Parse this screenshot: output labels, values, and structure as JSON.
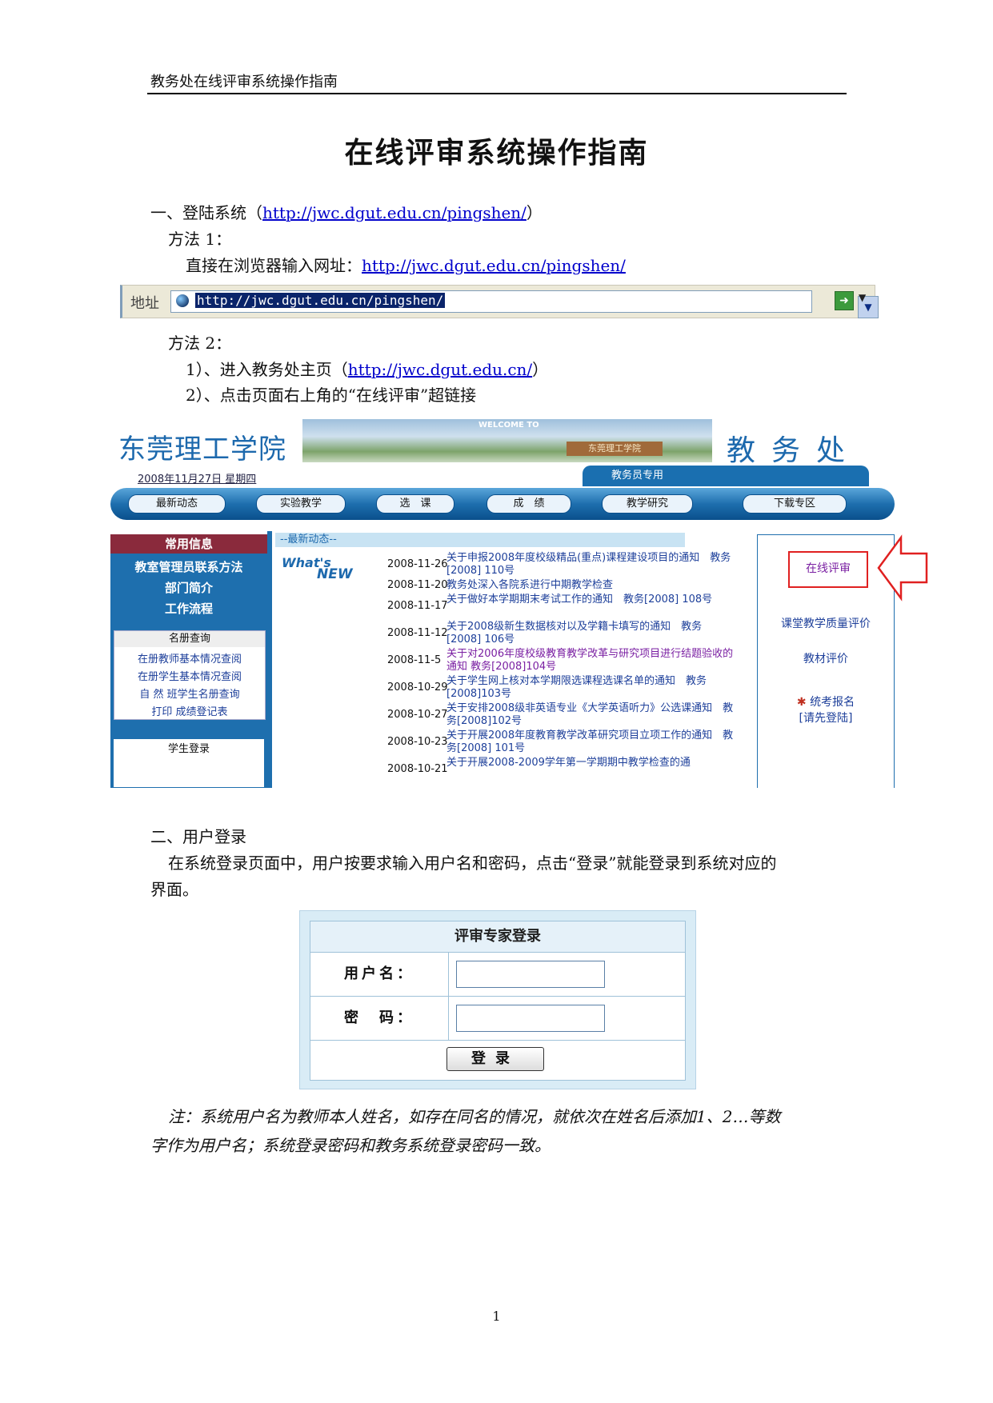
{
  "header": {
    "text": "教务处在线评审系统操作指南"
  },
  "title": "在线评审系统操作指南",
  "section1": {
    "heading_prefix": "一、登陆系统（",
    "heading_link": "http://jwc.dgut.edu.cn/pingshen/",
    "heading_suffix": "）",
    "method1": "方法 1：",
    "direct_prefix": "直接在浏览器输入网址：",
    "direct_link": "http://jwc.dgut.edu.cn/pingshen/",
    "method2": "方法 2：",
    "step1_prefix": "1）、进入教务处主页（",
    "step1_link": "http://jwc.dgut.edu.cn/",
    "step1_suffix": "）",
    "step2": "2）、点击页面右上角的“在线评审”超链接"
  },
  "address_bar": {
    "label": "地址",
    "url": "http://jwc.dgut.edu.cn/pingshen/"
  },
  "site": {
    "logo": "东莞理工学院",
    "banner_welcome": "WELCOME TO",
    "banner_sign": "东莞理工学院",
    "dept": "教务处",
    "date": "2008年11月27日 星期四",
    "staff_tab": "教务员专用",
    "nav": [
      "最新动态",
      "实验教学",
      "选　课",
      "成　绩",
      "教学研究",
      "下载专区"
    ],
    "left_head": "常用信息",
    "left_items": [
      "教室管理员联系方法",
      "部门简介",
      "工作流程"
    ],
    "roster_head": "名册查询",
    "roster_links": [
      "在册教师基本情况查阅",
      "在册学生基本情况查阅",
      "自 然 班学生名册查询",
      "打印 成绩登记表"
    ],
    "student_login": "学生登录",
    "news_head": "--最新动态--",
    "whats": "What's",
    "new": "NEW",
    "news": [
      {
        "date": "2008-11-26",
        "title": "关于申报2008年度校级精品(重点)课程建设项目的通知　教务[2008] 110号"
      },
      {
        "date": "2008-11-20",
        "title": "教务处深入各院系进行中期教学检查"
      },
      {
        "date": "2008-11-17",
        "title": "关于做好本学期期末考试工作的通知　教务[2008] 108号"
      },
      {
        "date": "2008-11-12",
        "title": "关于2008级新生数据核对以及学籍卡填写的通知　教务[2008] 106号"
      },
      {
        "date": "2008-11-5",
        "title": "关于对2006年度校级教育教学改革与研究项目进行结题验收的通知 教务[2008]104号"
      },
      {
        "date": "2008-10-29",
        "title": "关于学生网上核对本学期限选课程选课名单的通知　教务[2008]103号"
      },
      {
        "date": "2008-10-27",
        "title": "关于安排2008级非英语专业《大学英语听力》公选课通知　教务[2008]102号"
      },
      {
        "date": "2008-10-23",
        "title": "关于开展2008年度教育教学改革研究项目立项工作的通知　教务[2008] 101号"
      },
      {
        "date": "2008-10-21",
        "title": "关于开展2008-2009学年第一学期期中教学检查的通"
      }
    ],
    "right": {
      "online_review": "在线评审",
      "quality": "课堂教学质量评价",
      "textbook": "教材评价",
      "exam": "统考报名",
      "exam_note": "[请先登陆]"
    }
  },
  "section2": {
    "heading": "二、用户登录",
    "para": "在系统登录页面中，用户按要求输入用户名和密码，点击“登录”就能登录到系统对应的",
    "para2": "界面。"
  },
  "login": {
    "title": "评审专家登录",
    "user_label": "用户名：",
    "pass_label": "密　码：",
    "button": "登录"
  },
  "note": {
    "line1": "注：系统用户名为教师本人姓名，如存在同名的情况，就依次在姓名后添加1、2…等数",
    "line2": "字作为用户名；系统登录密码和教务系统登录密码一致。"
  },
  "page_number": "1"
}
